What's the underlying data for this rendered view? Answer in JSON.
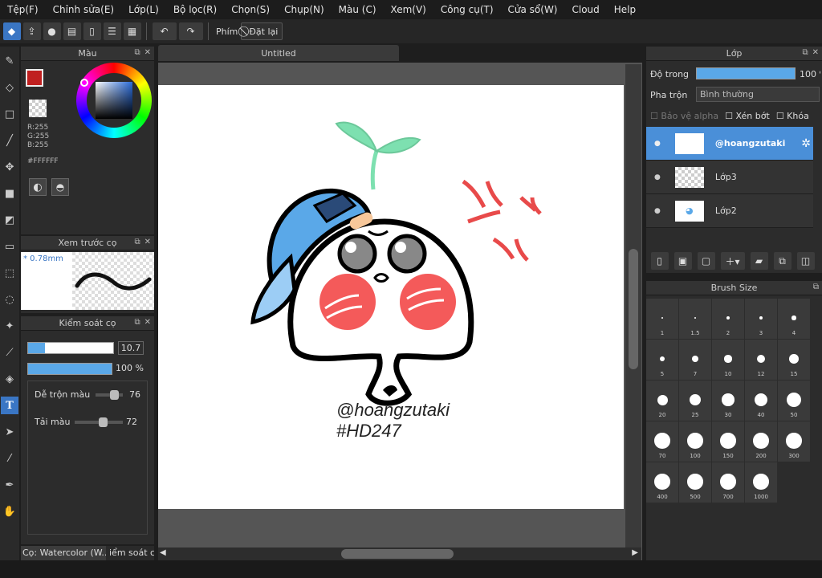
{
  "menu": [
    "Tệp(F)",
    "Chỉnh sửa(E)",
    "Lớp(L)",
    "Bộ lọc(R)",
    "Chọn(S)",
    "Chụp(N)",
    "Màu (C)",
    "Xem(V)",
    "Công cụ(T)",
    "Cửa sổ(W)",
    "Cloud",
    "Help"
  ],
  "toolbar": {
    "shortcut_label": "Phím",
    "reset_label": "Đặt lại"
  },
  "tab_title": "Untitled",
  "color_panel": {
    "title": "Màu",
    "r": "R:255",
    "g": "G:255",
    "b": "B:255",
    "hex": "#FFFFFF",
    "fg": "#c02020"
  },
  "preview_panel": {
    "title": "Xem trước cọ",
    "size": "* 0.78mm"
  },
  "brush_control": {
    "title": "Kiểm soát cọ",
    "size_value": "10.7",
    "size_fraction": 0.2,
    "opacity_value": "100 %",
    "opacity_fraction": 1.0,
    "blend_label": "Dễ trộn màu",
    "blend_value": "76",
    "amount_label": "Tải màu",
    "amount_value": "72"
  },
  "bottom_tabs": [
    "Cọ: Watercolor (W...",
    "iểm soát c"
  ],
  "canvas": {
    "signature": "@hoangzutaki",
    "tag": "#HD247"
  },
  "layer_panel": {
    "title": "Lớp",
    "opacity_label": "Độ trong",
    "opacity_value": "100 %",
    "opacity_fraction": 1.0,
    "blend_label": "Pha trộn",
    "blend_mode": "Bình thường",
    "protect_alpha": "Bảo vệ alpha",
    "clip": "Xén bớt",
    "lock": "Khóa",
    "layers": [
      {
        "name": "@hoangzutaki",
        "selected": true
      },
      {
        "name": "Lớp3",
        "selected": false
      },
      {
        "name": "Lớp2",
        "selected": false
      }
    ]
  },
  "brush_size_panel": {
    "title": "Brush Size",
    "sizes": [
      "1",
      "1.5",
      "2",
      "3",
      "4",
      "5",
      "7",
      "10",
      "12",
      "15",
      "20",
      "25",
      "30",
      "40",
      "50",
      "70",
      "100",
      "150",
      "200",
      "300",
      "400",
      "500",
      "700",
      "1000"
    ]
  },
  "colors": {
    "accent": "#3a76c4",
    "selection": "#4a8fd8",
    "blush": "#f45a5a",
    "cap": "#5aa8e8",
    "sprout": "#7de0b0"
  }
}
